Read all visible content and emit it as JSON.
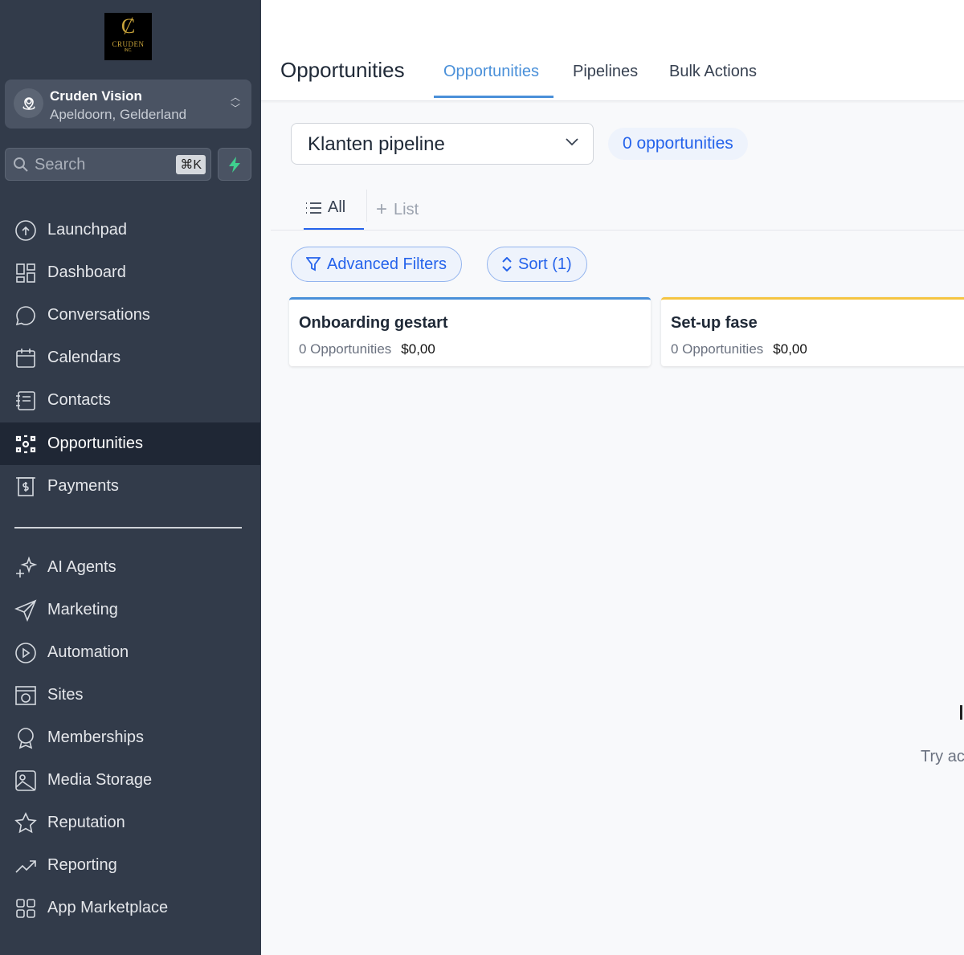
{
  "logo": {
    "text": "CRUDEN",
    "sub": "INC."
  },
  "location": {
    "name": "Cruden Vision",
    "address": "Apeldoorn, Gelderland"
  },
  "search": {
    "placeholder": "Search",
    "shortcut": "⌘K"
  },
  "nav_primary": [
    {
      "label": "Launchpad",
      "icon": "launchpad-icon"
    },
    {
      "label": "Dashboard",
      "icon": "dashboard-icon"
    },
    {
      "label": "Conversations",
      "icon": "chat-icon"
    },
    {
      "label": "Calendars",
      "icon": "calendar-icon"
    },
    {
      "label": "Contacts",
      "icon": "contacts-icon"
    },
    {
      "label": "Opportunities",
      "icon": "opportunities-icon",
      "active": true
    },
    {
      "label": "Payments",
      "icon": "payments-icon"
    }
  ],
  "nav_secondary": [
    {
      "label": "AI Agents"
    },
    {
      "label": "Marketing"
    },
    {
      "label": "Automation"
    },
    {
      "label": "Sites"
    },
    {
      "label": "Memberships"
    },
    {
      "label": "Media Storage"
    },
    {
      "label": "Reputation"
    },
    {
      "label": "Reporting"
    },
    {
      "label": "App Marketplace"
    }
  ],
  "header": {
    "title": "Opportunities",
    "tabs": [
      "Opportunities",
      "Pipelines",
      "Bulk Actions"
    ]
  },
  "pipeline": {
    "selected": "Klanten pipeline",
    "count": "0 opportunities"
  },
  "views": {
    "all": "All",
    "list": "List"
  },
  "filters": {
    "advanced": "Advanced Filters",
    "sort": "Sort (1)"
  },
  "stages": [
    {
      "title": "Onboarding gestart",
      "count": "0 Opportunities",
      "amount": "$0,00",
      "color": "#4a90d9"
    },
    {
      "title": "Set-up fase",
      "count": "0 Opportunities",
      "amount": "$0,00",
      "color": "#f5c542"
    }
  ],
  "empty": {
    "hint": "Try ac"
  }
}
